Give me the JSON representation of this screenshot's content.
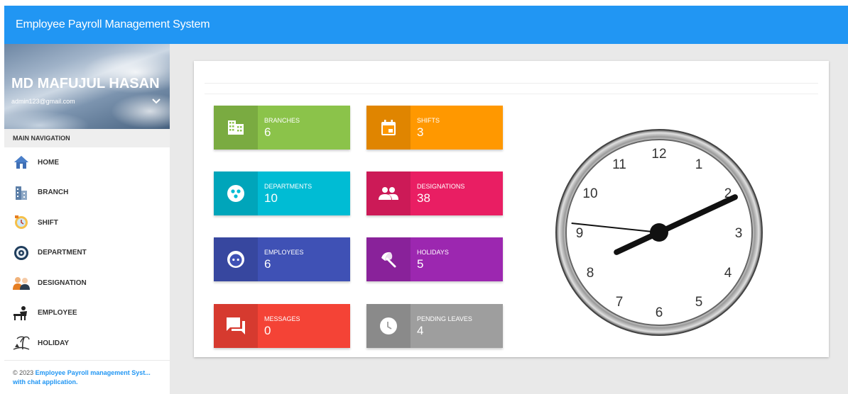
{
  "app": {
    "title": "Employee Payroll Management System"
  },
  "user": {
    "name": "MD MAFUJUL HASAN",
    "email": "admin123@gmail.com"
  },
  "sidebar": {
    "header": "MAIN NAVIGATION",
    "items": [
      {
        "label": "HOME",
        "icon": "home-icon"
      },
      {
        "label": "BRANCH",
        "icon": "building-icon"
      },
      {
        "label": "SHIFT",
        "icon": "clock-calendar-icon"
      },
      {
        "label": "DEPARTMENT",
        "icon": "department-emblem-icon"
      },
      {
        "label": "DESIGNATION",
        "icon": "people-icon"
      },
      {
        "label": "EMPLOYEE",
        "icon": "worker-desk-icon"
      },
      {
        "label": "HOLIDAY",
        "icon": "beach-icon"
      }
    ],
    "footer": {
      "copyright": "© 2023",
      "link": "Employee Payroll management Syst...",
      "link2": "with chat application."
    }
  },
  "stats": [
    {
      "label": "BRANCHES",
      "value": "6",
      "color": "#8bc34a",
      "icon": "domain-icon"
    },
    {
      "label": "SHIFTS",
      "value": "3",
      "color": "#ff9800",
      "icon": "calendar-icon"
    },
    {
      "label": "DEPARTMENTS",
      "value": "10",
      "color": "#00bcd4",
      "icon": "group-circle-icon"
    },
    {
      "label": "DESIGNATIONS",
      "value": "38",
      "color": "#e91e63",
      "icon": "people-icon"
    },
    {
      "label": "EMPLOYEES",
      "value": "6",
      "color": "#3f51b5",
      "icon": "face-icon"
    },
    {
      "label": "HOLIDAYS",
      "value": "5",
      "color": "#9c27b0",
      "icon": "beach-umbrella-icon"
    },
    {
      "label": "MESSAGES",
      "value": "0",
      "color": "#f44336",
      "icon": "chat-icon"
    },
    {
      "label": "PENDING LEAVES",
      "value": "4",
      "color": "#9e9e9e",
      "icon": "clock-icon"
    }
  ],
  "clock": {
    "numerals": [
      "12",
      "1",
      "2",
      "3",
      "4",
      "5",
      "6",
      "7",
      "8",
      "9",
      "10",
      "11"
    ],
    "hours": 2,
    "minutes": 10,
    "seconds": 46
  }
}
